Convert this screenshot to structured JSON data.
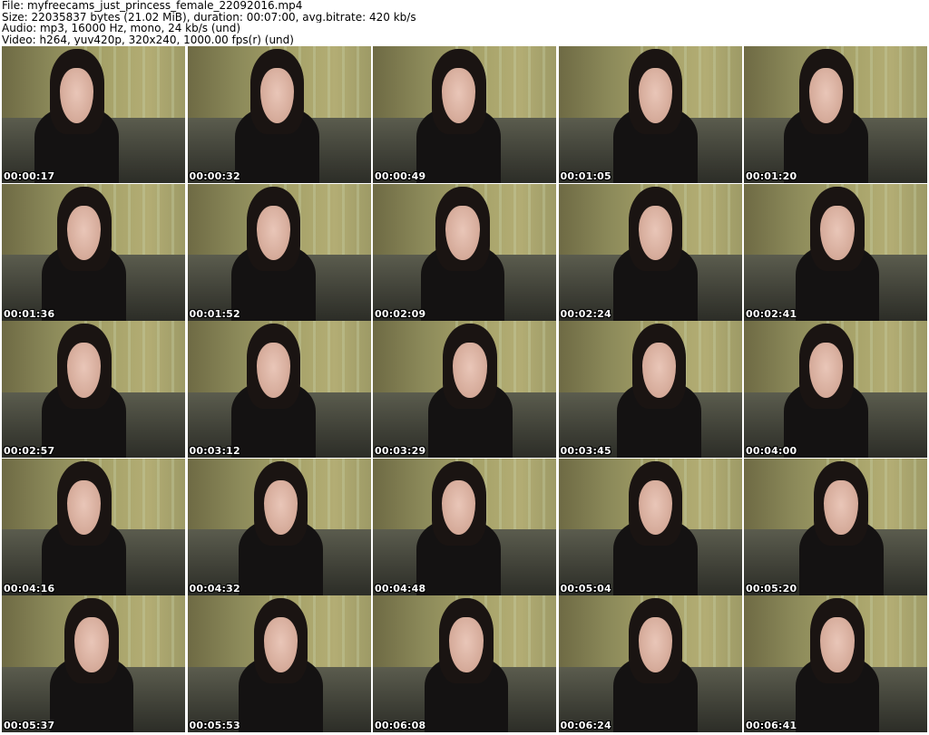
{
  "info": {
    "file": "File: myfreecams_just_princess_female_22092016.mp4",
    "size": "Size: 22035837 bytes (21.02 MiB), duration: 00:07:00, avg.bitrate: 420 kb/s",
    "audio": "Audio: mp3, 16000 Hz, mono, 24 kb/s (und)",
    "video": "Video: h264, yuv420p, 320x240, 1000.00 fps(r) (und)"
  },
  "thumbnails": [
    {
      "timestamp": "00:00:17"
    },
    {
      "timestamp": "00:00:32"
    },
    {
      "timestamp": "00:00:49"
    },
    {
      "timestamp": "00:01:05"
    },
    {
      "timestamp": "00:01:20"
    },
    {
      "timestamp": "00:01:36"
    },
    {
      "timestamp": "00:01:52"
    },
    {
      "timestamp": "00:02:09"
    },
    {
      "timestamp": "00:02:24"
    },
    {
      "timestamp": "00:02:41"
    },
    {
      "timestamp": "00:02:57"
    },
    {
      "timestamp": "00:03:12"
    },
    {
      "timestamp": "00:03:29"
    },
    {
      "timestamp": "00:03:45"
    },
    {
      "timestamp": "00:04:00"
    },
    {
      "timestamp": "00:04:16"
    },
    {
      "timestamp": "00:04:32"
    },
    {
      "timestamp": "00:04:48"
    },
    {
      "timestamp": "00:05:04"
    },
    {
      "timestamp": "00:05:20"
    },
    {
      "timestamp": "00:05:37"
    },
    {
      "timestamp": "00:05:53"
    },
    {
      "timestamp": "00:06:08"
    },
    {
      "timestamp": "00:06:24"
    },
    {
      "timestamp": "00:06:41"
    }
  ]
}
